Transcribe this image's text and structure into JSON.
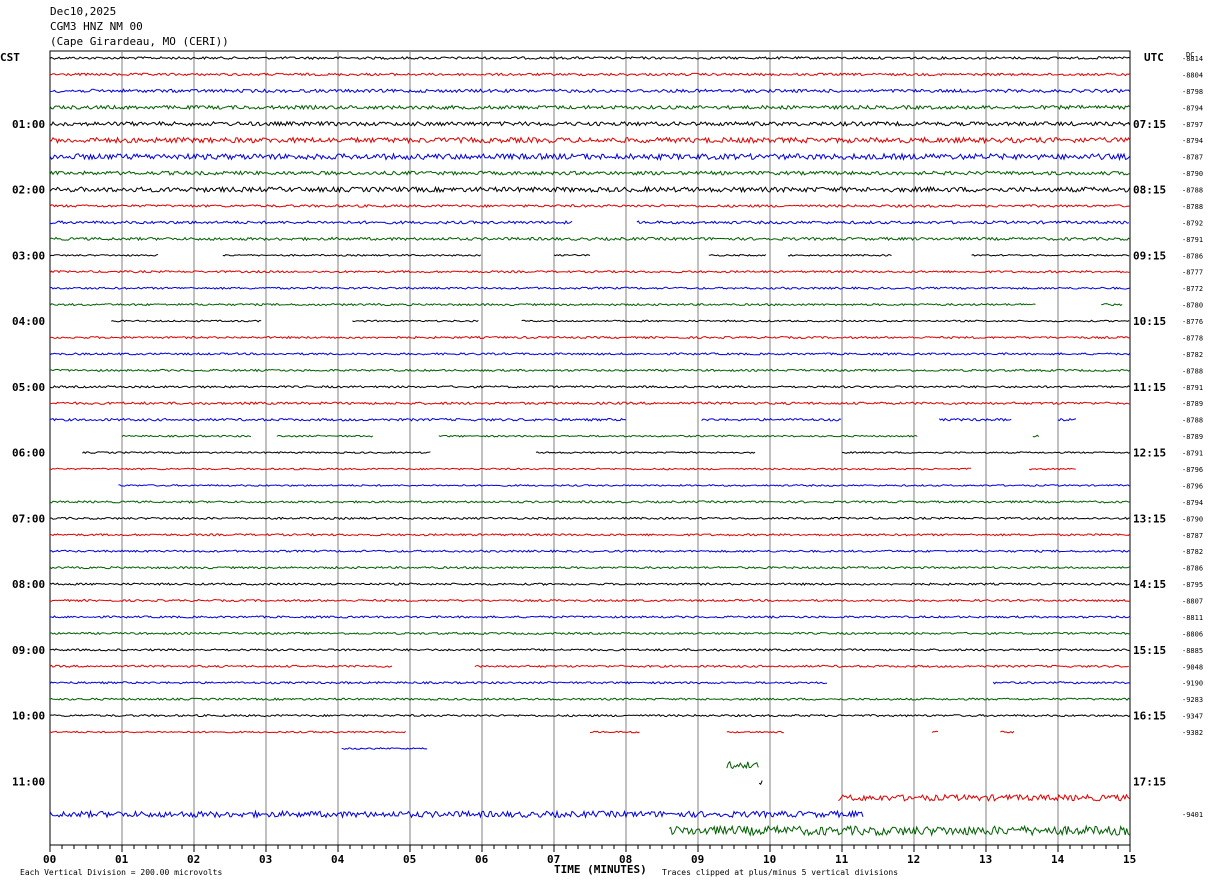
{
  "header": {
    "date": "Dec10,2025",
    "station": "CGM3 HNZ NM 00",
    "location": "(Cape Girardeau, MO (CERI))",
    "left_zone": "CST",
    "right_zone": "UTC",
    "dc_label": "DC"
  },
  "footer": {
    "scale_note": "Each Vertical Division =  200.00 microvolts",
    "xlabel": "TIME (MINUTES)",
    "clip_note": "Traces clipped at plus/minus 5 vertical divisions"
  },
  "colors": {
    "trace_cycle": [
      "#000000",
      "#e00000",
      "#0000e0",
      "#006000"
    ],
    "grid": "#808080"
  },
  "chart_data": {
    "type": "line",
    "title": "CGM3 HNZ NM 00",
    "xlabel": "TIME (MINUTES)",
    "xlim": [
      0,
      15
    ],
    "x_ticks": [
      "00",
      "01",
      "02",
      "03",
      "04",
      "05",
      "06",
      "07",
      "08",
      "09",
      "10",
      "11",
      "12",
      "13",
      "14",
      "15"
    ],
    "left_hour_labels": [
      "01:00",
      "02:00",
      "03:00",
      "04:00",
      "05:00",
      "06:00",
      "07:00",
      "08:00",
      "09:00",
      "10:00",
      "11:00"
    ],
    "right_hour_labels": [
      "07:15",
      "08:15",
      "09:15",
      "10:15",
      "11:15",
      "12:15",
      "13:15",
      "14:15",
      "15:15",
      "16:15",
      "17:15"
    ],
    "dc_offsets": [
      "-8814",
      "-8804",
      "-8798",
      "-8794",
      "-8797",
      "-8794",
      "-8787",
      "-8790",
      "-8788",
      "-8788",
      "-8792",
      "-8791",
      "-8786",
      "-8777",
      "-8772",
      "-8780",
      "-8776",
      "-8778",
      "-8782",
      "-8788",
      "-8791",
      "-8789",
      "-8788",
      "-8789",
      "-8791",
      "-8796",
      "-8796",
      "-8794",
      "-8790",
      "-8787",
      "-8782",
      "-8786",
      "-8795",
      "-8807",
      "-8811",
      "-8806",
      "-8885",
      "-9048",
      "-9190",
      "-9283",
      "-9347",
      "-9382",
      "",
      "",
      "",
      "",
      "-9401",
      ""
    ],
    "traces": [
      {
        "segments": [
          [
            0,
            15
          ]
        ],
        "amp": 1.2
      },
      {
        "segments": [
          [
            0,
            15
          ]
        ],
        "amp": 1.2
      },
      {
        "segments": [
          [
            0,
            15
          ]
        ],
        "amp": 1.6
      },
      {
        "segments": [
          [
            0,
            15
          ]
        ],
        "amp": 1.8
      },
      {
        "segments": [
          [
            0,
            15
          ]
        ],
        "amp": 2.0
      },
      {
        "segments": [
          [
            0,
            15
          ]
        ],
        "amp": 2.6
      },
      {
        "segments": [
          [
            0,
            15
          ]
        ],
        "amp": 2.8
      },
      {
        "segments": [
          [
            0,
            15
          ]
        ],
        "amp": 1.8
      },
      {
        "segments": [
          [
            0,
            15
          ]
        ],
        "amp": 2.4
      },
      {
        "segments": [
          [
            0,
            15
          ]
        ],
        "amp": 1.2
      },
      {
        "segments": [
          [
            0,
            7.25
          ],
          [
            8.15,
            15
          ]
        ],
        "amp": 1.4
      },
      {
        "segments": [
          [
            0,
            15
          ]
        ],
        "amp": 1.4
      },
      {
        "segments": [
          [
            0,
            1.5
          ],
          [
            2.4,
            6.0
          ],
          [
            7.0,
            7.5
          ],
          [
            9.15,
            9.95
          ],
          [
            10.25,
            11.7
          ],
          [
            12.8,
            15
          ]
        ],
        "amp": 0.8
      },
      {
        "segments": [
          [
            0,
            15
          ]
        ],
        "amp": 1.0
      },
      {
        "segments": [
          [
            0,
            15
          ]
        ],
        "amp": 1.0
      },
      {
        "segments": [
          [
            0,
            13.7
          ],
          [
            14.6,
            14.9
          ]
        ],
        "amp": 1.0
      },
      {
        "segments": [
          [
            0.85,
            2.95
          ],
          [
            4.2,
            5.95
          ],
          [
            6.55,
            15
          ]
        ],
        "amp": 0.8
      },
      {
        "segments": [
          [
            0,
            15
          ]
        ],
        "amp": 1.0
      },
      {
        "segments": [
          [
            0,
            15
          ]
        ],
        "amp": 1.0
      },
      {
        "segments": [
          [
            0,
            15
          ]
        ],
        "amp": 1.0
      },
      {
        "segments": [
          [
            0,
            15
          ]
        ],
        "amp": 1.0
      },
      {
        "segments": [
          [
            0,
            15
          ]
        ],
        "amp": 1.2
      },
      {
        "segments": [
          [
            0,
            8.0
          ],
          [
            9.05,
            11.0
          ],
          [
            12.35,
            13.35
          ],
          [
            14.0,
            14.25
          ]
        ],
        "amp": 1.2
      },
      {
        "segments": [
          [
            1.0,
            2.8
          ],
          [
            3.15,
            4.5
          ],
          [
            5.4,
            12.05
          ],
          [
            13.65,
            13.75
          ]
        ],
        "amp": 0.8
      },
      {
        "segments": [
          [
            0.45,
            5.3
          ],
          [
            6.75,
            9.8
          ],
          [
            11.0,
            15
          ]
        ],
        "amp": 0.8
      },
      {
        "segments": [
          [
            0,
            12.8
          ],
          [
            13.6,
            14.25
          ]
        ],
        "amp": 0.8
      },
      {
        "segments": [
          [
            0.95,
            15
          ]
        ],
        "amp": 0.8
      },
      {
        "segments": [
          [
            0,
            15
          ]
        ],
        "amp": 1.0
      },
      {
        "segments": [
          [
            0,
            15
          ]
        ],
        "amp": 1.0
      },
      {
        "segments": [
          [
            0,
            15
          ]
        ],
        "amp": 1.0
      },
      {
        "segments": [
          [
            0,
            15
          ]
        ],
        "amp": 1.0
      },
      {
        "segments": [
          [
            0,
            15
          ]
        ],
        "amp": 1.0
      },
      {
        "segments": [
          [
            0,
            15
          ]
        ],
        "amp": 1.0
      },
      {
        "segments": [
          [
            0,
            15
          ]
        ],
        "amp": 1.0
      },
      {
        "segments": [
          [
            0,
            15
          ]
        ],
        "amp": 1.0
      },
      {
        "segments": [
          [
            0,
            15
          ]
        ],
        "amp": 1.0
      },
      {
        "segments": [
          [
            0,
            15
          ]
        ],
        "amp": 1.0
      },
      {
        "segments": [
          [
            0,
            4.75
          ],
          [
            5.9,
            15
          ]
        ],
        "amp": 1.0
      },
      {
        "segments": [
          [
            0,
            10.8
          ],
          [
            13.1,
            15
          ]
        ],
        "amp": 1.0
      },
      {
        "segments": [
          [
            0,
            15
          ]
        ],
        "amp": 1.0
      },
      {
        "segments": [
          [
            0,
            15
          ]
        ],
        "amp": 1.0
      },
      {
        "segments": [
          [
            0,
            4.95
          ],
          [
            7.5,
            8.2
          ],
          [
            9.4,
            10.2
          ],
          [
            12.25,
            12.35
          ],
          [
            13.2,
            13.4
          ]
        ],
        "amp": 0.8
      },
      {
        "segments": [
          [
            4.05,
            5.25
          ]
        ],
        "amp": 0.8
      },
      {
        "segments": [
          [
            9.4,
            9.85
          ]
        ],
        "amp": 3.5
      },
      {
        "segments": [
          [
            9.85,
            9.9
          ]
        ],
        "amp": 3.0
      },
      {
        "segments": [
          [
            10.95,
            15
          ]
        ],
        "amp": 3.0
      },
      {
        "segments": [
          [
            0,
            11.3
          ]
        ],
        "amp": 3.0
      },
      {
        "segments": [
          [
            8.6,
            15
          ]
        ],
        "amp": 4.5
      }
    ]
  }
}
